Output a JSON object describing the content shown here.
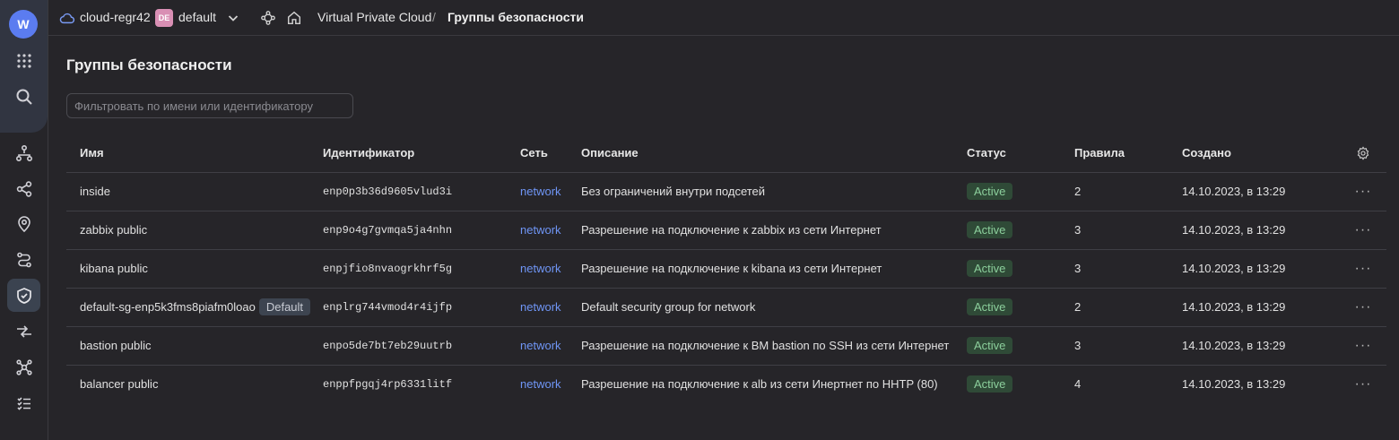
{
  "topbar": {
    "cloud_name": "cloud-regr42",
    "folder_badge": "DE",
    "folder_name": "default",
    "breadcrumb": [
      "Virtual Private Cloud",
      "Группы безопасности"
    ],
    "separator": "/"
  },
  "rail": {
    "logo_letter": "W",
    "icons": [
      "grid-icon",
      "search-icon",
      "network-topology-icon",
      "share-nodes-icon",
      "location-pin-icon",
      "route-icon",
      "shield-icon",
      "transfer-arrows-icon",
      "hub-icon",
      "checklist-icon"
    ],
    "active": "shield-icon"
  },
  "page": {
    "title": "Группы безопасности",
    "filter_placeholder": "Фильтровать по имени или идентификатору"
  },
  "table": {
    "headers": {
      "name": "Имя",
      "id": "Идентификатор",
      "network": "Сеть",
      "description": "Описание",
      "status": "Статус",
      "rules": "Правила",
      "created": "Создано"
    },
    "rows": [
      {
        "name": "inside",
        "badge": "",
        "id": "enp0p3b36d9605vlud3i",
        "network": "network",
        "description": "Без ограничений внутри подсетей",
        "status": "Active",
        "rules": "2",
        "created": "14.10.2023, в 13:29"
      },
      {
        "name": "zabbix public",
        "badge": "",
        "id": "enp9o4g7gvmqa5ja4nhn",
        "network": "network",
        "description": "Разрешение на подключение к zabbix из сети Интернет",
        "status": "Active",
        "rules": "3",
        "created": "14.10.2023, в 13:29"
      },
      {
        "name": "kibana public",
        "badge": "",
        "id": "enpjfio8nvaogrkhrf5g",
        "network": "network",
        "description": "Разрешение на подключение к kibana из сети Интернет",
        "status": "Active",
        "rules": "3",
        "created": "14.10.2023, в 13:29"
      },
      {
        "name": "default-sg-enp5k3fms8piafm0loao",
        "badge": "Default",
        "id": "enplrg744vmod4r4ijfp",
        "network": "network",
        "description": "Default security group for network",
        "status": "Active",
        "rules": "2",
        "created": "14.10.2023, в 13:29"
      },
      {
        "name": "bastion public",
        "badge": "",
        "id": "enpo5de7bt7eb29uutrb",
        "network": "network",
        "description": "Разрешение на подключение к ВМ bastion по SSH из сети Интернет",
        "status": "Active",
        "rules": "3",
        "created": "14.10.2023, в 13:29"
      },
      {
        "name": "balancer public",
        "badge": "",
        "id": "enppfpgqj4rp6331litf",
        "network": "network",
        "description": "Разрешение на подключение к alb из сети Инертнет по HHTP (80)",
        "status": "Active",
        "rules": "4",
        "created": "14.10.2023, в 13:29"
      }
    ],
    "row_action": "···"
  },
  "colors": {
    "background": "#262529",
    "accent": "#5b7cf0",
    "link": "#6f95f5",
    "status_active_bg": "#2f4a37",
    "status_active_text": "#8ccf9c"
  }
}
